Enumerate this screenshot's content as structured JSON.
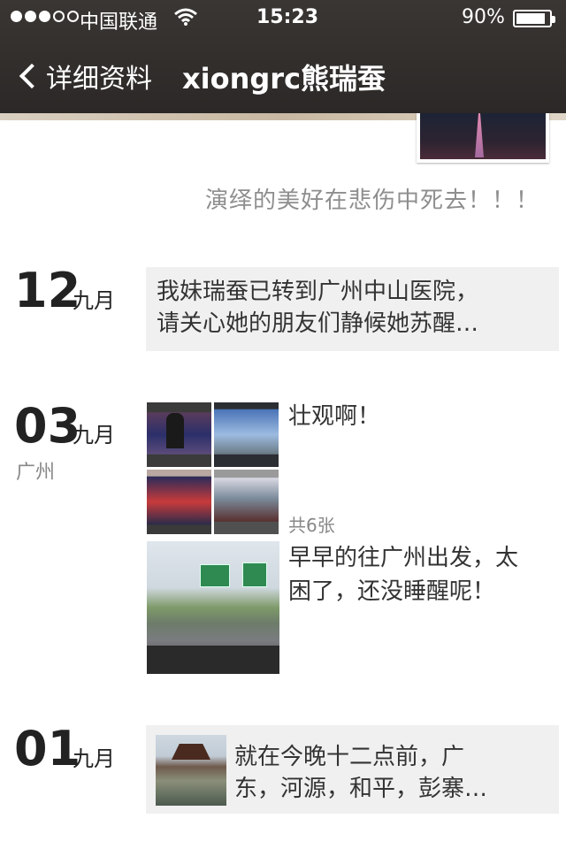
{
  "status_bar": {
    "carrier": "中国联通",
    "time": "15:23",
    "battery": "90%",
    "battery_level": 0.9,
    "signal_dots_filled": 3,
    "signal_dots_total": 5
  },
  "nav": {
    "back_label": "详细资料",
    "title": "xiongrc熊瑞蚕"
  },
  "profile": {
    "signature": "演绎的美好在悲伤中死去！！！"
  },
  "posts": [
    {
      "day": "12",
      "month": "九月",
      "text_line1": "我妹瑞蚕已转到广州中山医院，",
      "text_line2": "请关心她的朋友们静候她苏醒…"
    },
    {
      "day": "03",
      "month": "九月",
      "location": "广州",
      "entries": [
        {
          "text": "壮观啊！",
          "count_label": "共6张"
        },
        {
          "text_line1": "早早的往广州出发，太",
          "text_line2": "困了，还没睡醒呢！"
        }
      ]
    },
    {
      "day": "01",
      "month": "九月",
      "text_line1": "就在今晚十二点前，广",
      "text_line2": "东，河源，和平，彭寨…"
    }
  ]
}
